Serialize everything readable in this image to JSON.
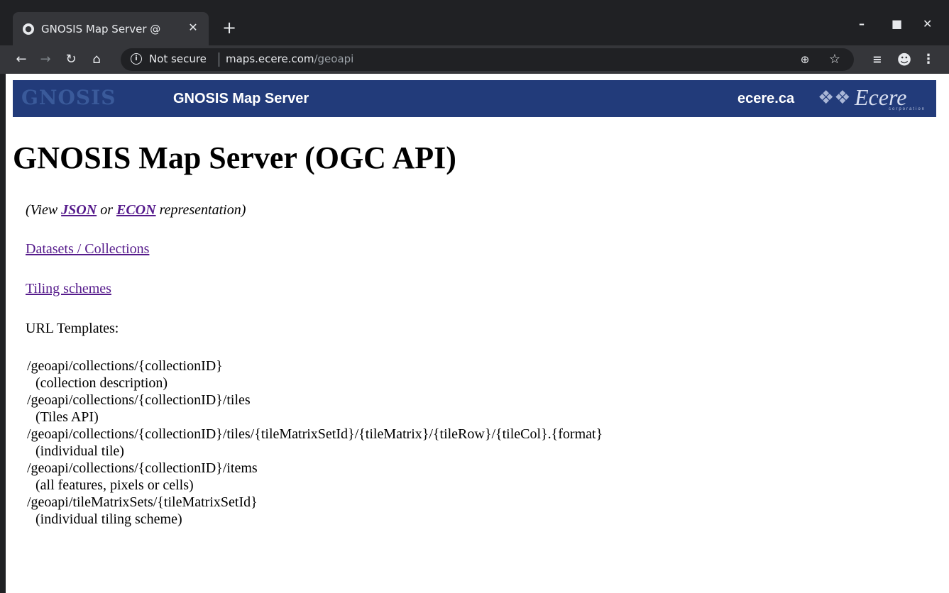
{
  "browser": {
    "tab": {
      "title": "GNOSIS Map Server @"
    },
    "address": {
      "security_label": "Not secure",
      "host": "maps.ecere.com",
      "path": "/geoapi"
    }
  },
  "banner": {
    "logo_text": "GNOSIS",
    "title": "GNOSIS Map Server",
    "link": "ecere.ca",
    "ecere_logo_text": "Ecere",
    "ecere_logo_sub": "corporation"
  },
  "page": {
    "heading": "GNOSIS Map Server (OGC API)",
    "view_prefix": "(View ",
    "json_link": "JSON",
    "view_or": " or ",
    "econ_link": "ECON",
    "view_suffix": " representation)",
    "datasets_link": "Datasets / Collections",
    "tiling_link": "Tiling schemes",
    "url_templates_label": "URL Templates:",
    "templates": [
      {
        "path": "/geoapi/collections/{collectionID}",
        "desc": "(collection description)"
      },
      {
        "path": "/geoapi/collections/{collectionID}/tiles",
        "desc": "(Tiles API)"
      },
      {
        "path": "/geoapi/collections/{collectionID}/tiles/{tileMatrixSetId}/{tileMatrix}/{tileRow}/{tileCol}.{format}",
        "desc": "(individual tile)"
      },
      {
        "path": "/geoapi/collections/{collectionID}/items",
        "desc": "(all features, pixels or cells)"
      },
      {
        "path": "/geoapi/tileMatrixSets/{tileMatrixSetId}",
        "desc": "(individual tiling scheme)"
      }
    ]
  }
}
